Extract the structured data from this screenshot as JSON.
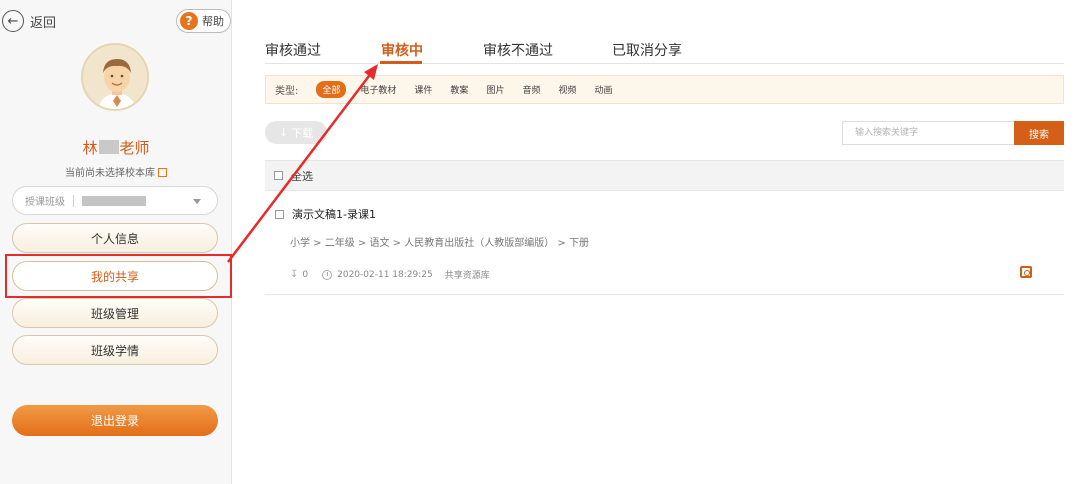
{
  "sidebar": {
    "back_label": "返回",
    "help_label": "帮助",
    "teacher_name_prefix": "林",
    "teacher_name_suffix": "老师",
    "school_note": "当前尚未选择校本库",
    "class_select_placeholder": "授课班级",
    "menu": [
      "个人信息",
      "我的共享",
      "班级管理",
      "班级学情"
    ],
    "active_menu": "我的共享",
    "logout_label": "退出登录"
  },
  "main": {
    "tabs": [
      "审核通过",
      "审核中",
      "审核不通过",
      "已取消分享"
    ],
    "active_tab": "审核中",
    "filter": {
      "label": "类型:",
      "chips": [
        "全部",
        "电子教材",
        "课件",
        "教案",
        "图片",
        "音频",
        "视频",
        "动画"
      ],
      "active": "全部"
    },
    "download_label": "下载",
    "search": {
      "placeholder": "输入搜索关键字",
      "button_label": "搜索"
    },
    "select_all_label": "全选",
    "items": [
      {
        "title": "演示文稿1-录课1",
        "path": "小学 > 二年级 > 语文 > 人民教育出版社（人教版部编版） > 下册",
        "downloads": "0",
        "date": "2020-02-11 18:29:25",
        "library": "共享资源库"
      }
    ]
  },
  "colors": {
    "accent": "#d35c1a",
    "annotation_red": "#e52b2b",
    "logout_orange": "#e46e18"
  }
}
